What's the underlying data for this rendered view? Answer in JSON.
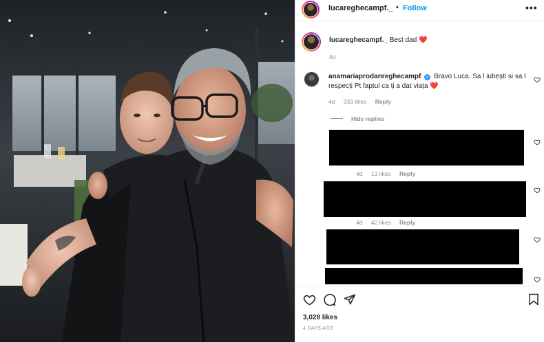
{
  "post": {
    "username": "lucareghecampf._",
    "separator": "•",
    "follow_label": "Follow",
    "more_label": "•••"
  },
  "caption": {
    "username": "lucareghecampf._",
    "text": "Best dad",
    "emoji": "❤️",
    "age": "4d"
  },
  "comment": {
    "username": "anamariaprodanreghecampf",
    "verified": "✓",
    "text_line1": "Bravo Luca. Sa l iubești si sa l",
    "text_line2": "respecți Pt faptul ca ți a dat viața",
    "age": "4d",
    "likes": "333 likes",
    "reply_label": "Reply"
  },
  "hide_replies_label": "Hide replies",
  "replies": [
    {
      "age": "4d",
      "likes": "13 likes",
      "reply_label": "Reply"
    },
    {
      "age": "4d",
      "likes": "42 likes",
      "reply_label": "Reply"
    }
  ],
  "footer": {
    "likes": "3,028 likes",
    "posted": "4 DAYS AGO"
  },
  "icons": {
    "like": "heart-icon",
    "comment": "comment-icon",
    "share": "share-icon",
    "save": "bookmark-icon"
  },
  "colors": {
    "accent": "#0095f6",
    "heart": "#ed4956",
    "muted": "#8e8e8e",
    "verified": "#3897f0"
  }
}
